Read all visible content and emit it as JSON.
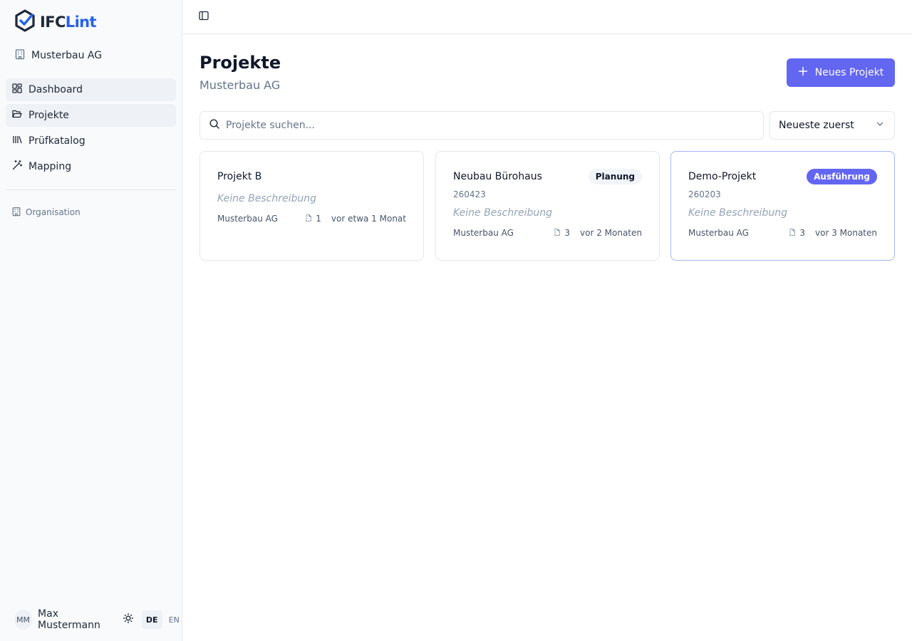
{
  "app": {
    "logo_main": "IFC",
    "logo_accent": "Lint",
    "colors": {
      "accent": "#6366f1",
      "logo_accent": "#2563eb"
    }
  },
  "sidebar": {
    "org_name": "Musterbau AG",
    "items": [
      {
        "label": "Dashboard",
        "icon": "dashboard-icon"
      },
      {
        "label": "Projekte",
        "icon": "folder-open-icon"
      },
      {
        "label": "Prüfkatalog",
        "icon": "library-icon"
      },
      {
        "label": "Mapping",
        "icon": "wand-icon"
      }
    ],
    "org_link": "Organisation",
    "user": {
      "initials": "MM",
      "name": "Max Mustermann"
    },
    "languages": [
      "DE",
      "EN"
    ],
    "active_language": "DE"
  },
  "header": {
    "title": "Projekte",
    "subtitle": "Musterbau AG",
    "new_button": "Neues Projekt"
  },
  "search": {
    "placeholder": "Projekte suchen...",
    "value": ""
  },
  "sort": {
    "selected": "Neueste zuerst"
  },
  "projects": [
    {
      "name": "Projekt B",
      "number": "",
      "status": "",
      "description": "Keine Beschreibung",
      "org": "Musterbau AG",
      "models": "1",
      "updated": "vor etwa 1 Monat"
    },
    {
      "name": "Neubau Bürohaus",
      "number": "260423",
      "status": "Planung",
      "description": "Keine Beschreibung",
      "org": "Musterbau AG",
      "models": "3",
      "updated": "vor 2 Monaten"
    },
    {
      "name": "Demo-Projekt",
      "number": "260203",
      "status": "Ausführung",
      "description": "Keine Beschreibung",
      "org": "Musterbau AG",
      "models": "3",
      "updated": "vor 3 Monaten"
    }
  ]
}
